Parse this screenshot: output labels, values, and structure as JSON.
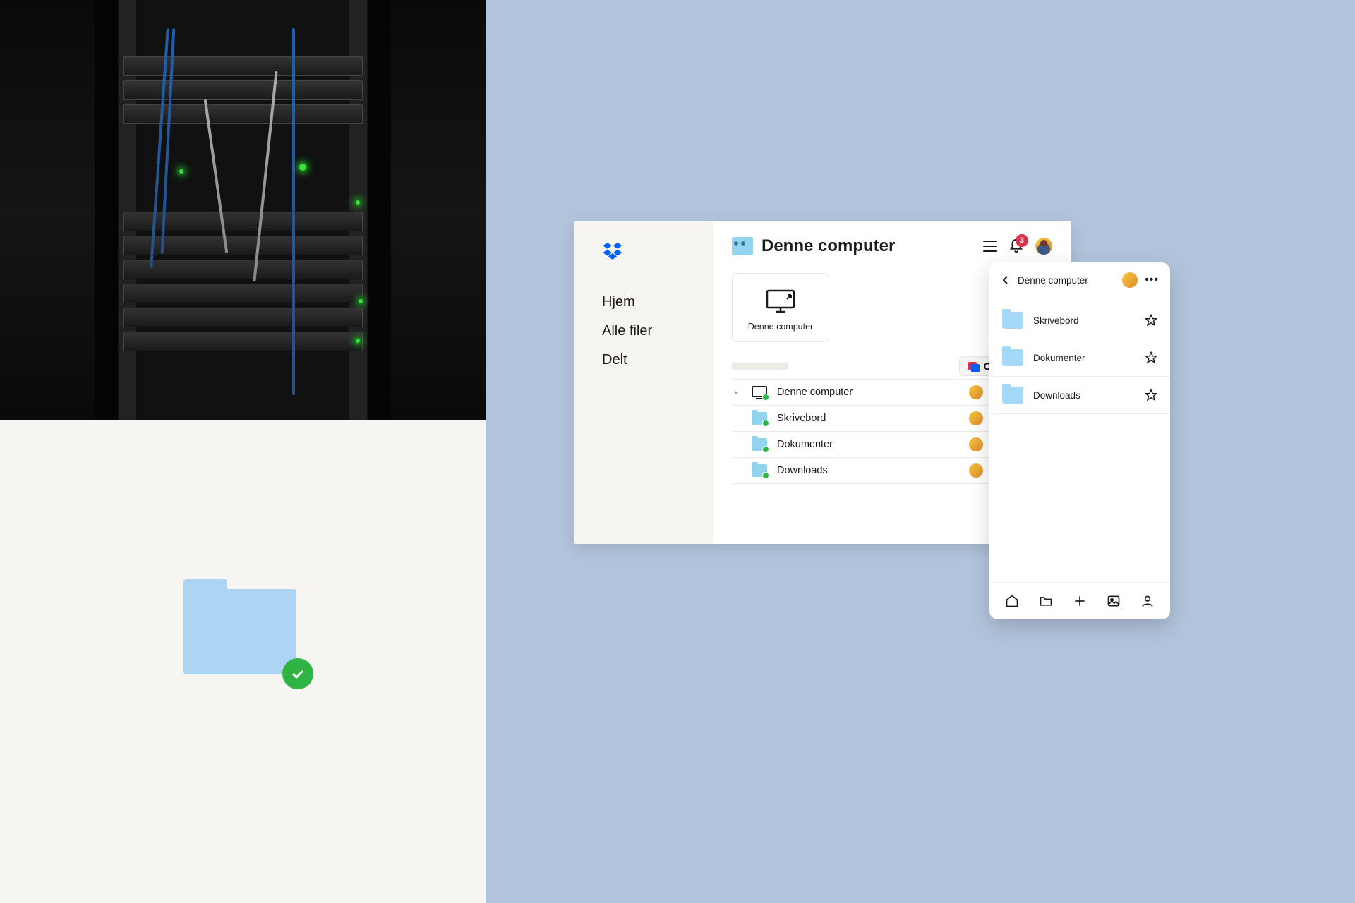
{
  "left": {
    "folder_badge": "checkmark"
  },
  "desktop": {
    "title": "Denne computer",
    "notification_count": "3",
    "nav": [
      {
        "label": "Hjem"
      },
      {
        "label": "Alle filer"
      },
      {
        "label": "Delt"
      }
    ],
    "card": {
      "label": "Denne computer"
    },
    "create_button": "Opret",
    "rows": [
      {
        "name": "Denne computer",
        "type": "computer"
      },
      {
        "name": "Skrivebord",
        "type": "folder"
      },
      {
        "name": "Dokumenter",
        "type": "folder"
      },
      {
        "name": "Downloads",
        "type": "folder"
      }
    ]
  },
  "mobile": {
    "title": "Denne computer",
    "folders": [
      {
        "name": "Skrivebord"
      },
      {
        "name": "Dokumenter"
      },
      {
        "name": "Downloads"
      }
    ],
    "bottom_icons": [
      "home",
      "folder",
      "plus",
      "photo",
      "person"
    ]
  }
}
